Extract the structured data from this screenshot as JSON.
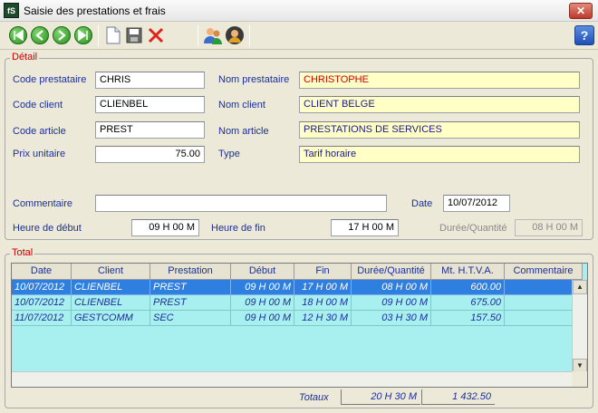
{
  "window": {
    "title": "Saisie des prestations et frais",
    "icon_text": "fS"
  },
  "toolbar": {
    "icons": [
      "first-icon",
      "previous-icon",
      "next-icon",
      "last-icon",
      "new-document-icon",
      "save-icon",
      "delete-icon",
      "users-icon",
      "user-icon"
    ],
    "help": "?"
  },
  "detail": {
    "label": "Détail",
    "code_prestataire": {
      "label": "Code prestataire",
      "value": "CHRIS"
    },
    "nom_prestataire": {
      "label": "Nom prestataire",
      "value": "CHRISTOPHE"
    },
    "code_client": {
      "label": "Code client",
      "value": "CLIENBEL"
    },
    "nom_client": {
      "label": "Nom client",
      "value": "CLIENT BELGE"
    },
    "code_article": {
      "label": "Code article",
      "value": "PREST"
    },
    "nom_article": {
      "label": "Nom article",
      "value": "PRESTATIONS DE SERVICES"
    },
    "prix_unitaire": {
      "label": "Prix unitaire",
      "value": "75.00"
    },
    "type": {
      "label": "Type",
      "value": "Tarif horaire"
    },
    "commentaire": {
      "label": "Commentaire",
      "value": ""
    },
    "date": {
      "label": "Date",
      "value": "10/07/2012"
    },
    "heure_debut": {
      "label": "Heure de début",
      "value": "09 H 00 M"
    },
    "heure_fin": {
      "label": "Heure de fin",
      "value": "17 H 00 M"
    },
    "duree": {
      "label": "Durée/Quantité",
      "value": "08 H 00 M"
    }
  },
  "total": {
    "label": "Total",
    "columns": [
      "Date",
      "Client",
      "Prestation",
      "Début",
      "Fin",
      "Durée/Quantité",
      "Mt. H.T.V.A.",
      "Commentaire"
    ],
    "rows": [
      {
        "date": "10/07/2012",
        "client": "CLIENBEL",
        "prestation": "PREST",
        "debut": "09 H 00 M",
        "fin": "17 H 00 M",
        "duree": "08 H 00 M",
        "montant": "600.00",
        "commentaire": ""
      },
      {
        "date": "10/07/2012",
        "client": "CLIENBEL",
        "prestation": "PREST",
        "debut": "09 H 00 M",
        "fin": "18 H 00 M",
        "duree": "09 H 00 M",
        "montant": "675.00",
        "commentaire": ""
      },
      {
        "date": "11/07/2012",
        "client": "GESTCOMM",
        "prestation": "SEC",
        "debut": "09 H 00 M",
        "fin": "12 H 30 M",
        "duree": "03 H 30 M",
        "montant": "157.50",
        "commentaire": ""
      }
    ],
    "totaux_label": "Totaux",
    "totaux_duree": "20 H 30 M",
    "totaux_montant": "1 432.50"
  }
}
